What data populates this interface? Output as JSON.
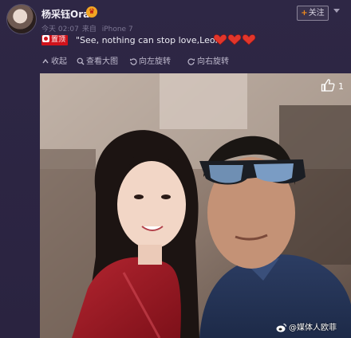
{
  "header": {
    "username": "杨采钰Ora",
    "time": "今天 02:07",
    "source_prefix": "来自",
    "source": "iPhone 7",
    "follow_label": "关注"
  },
  "post": {
    "tag_label": "置顶",
    "text": "\"See, nothing can stop love,Leon\"",
    "emoji": "heart-emoji x3"
  },
  "toolbar": {
    "items": [
      {
        "label": "收起",
        "icon": "collapse-icon"
      },
      {
        "label": "查看大图",
        "icon": "zoom-icon"
      },
      {
        "label": "向左旋转",
        "icon": "rotate-left-icon"
      },
      {
        "label": "向右旋转",
        "icon": "rotate-right-icon"
      }
    ]
  },
  "photo": {
    "like_count": "1",
    "watermark": "@媒体人欧菲"
  },
  "colors": {
    "background": "#2b2440",
    "tag": "#d0121b",
    "follow_plus": "#f08a1d",
    "heart": "#e2362b"
  }
}
